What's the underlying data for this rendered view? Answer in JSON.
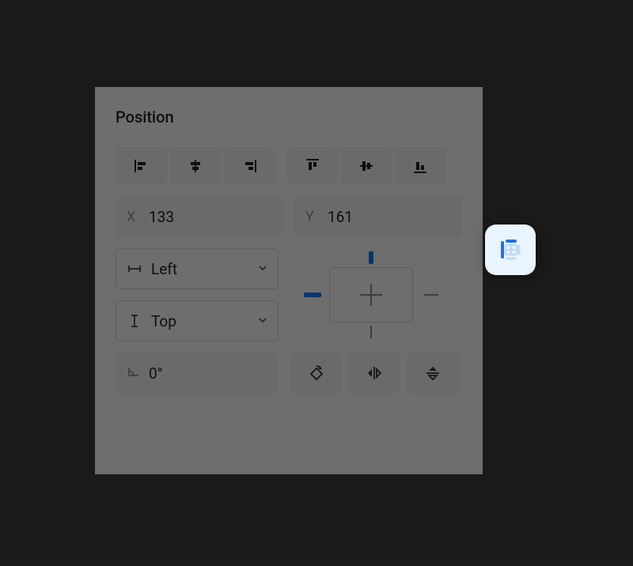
{
  "section": {
    "title": "Position"
  },
  "coords": {
    "x_label": "X",
    "x_value": "133",
    "y_label": "Y",
    "y_value": "161"
  },
  "constraints": {
    "horizontal_label": "Left",
    "vertical_label": "Top"
  },
  "rotation": {
    "value": "0°"
  },
  "colors": {
    "accent": "#1a73e8"
  },
  "icons": {
    "align_left": "align-left-icon",
    "align_hcenter": "align-hcenter-icon",
    "align_right": "align-right-icon",
    "align_top": "align-top-icon",
    "align_vcenter": "align-vcenter-icon",
    "align_bottom": "align-bottom-icon",
    "constraint_h": "constraint-horizontal-icon",
    "constraint_v": "constraint-vertical-icon",
    "angle": "angle-icon",
    "rotate90": "rotate-90-icon",
    "flip_h": "flip-horizontal-icon",
    "flip_v": "flip-vertical-icon",
    "absolute_position": "absolute-position-icon"
  }
}
